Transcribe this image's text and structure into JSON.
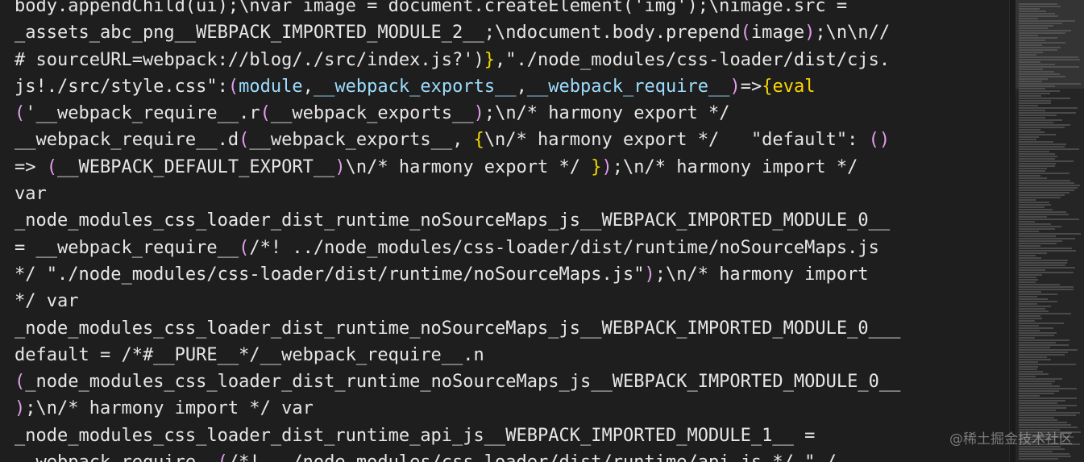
{
  "editor": {
    "lines": [
      [
        {
          "t": "body.appendChild(ui);\\nvar image = document.createElement('img');\\nimage.src =",
          "c": "default"
        }
      ],
      [
        {
          "t": "_assets_abc_png__WEBPACK_IMPORTED_MODULE_2__;\\ndocument.body.prepend",
          "c": "default"
        },
        {
          "t": "(",
          "c": "paren"
        },
        {
          "t": "image",
          "c": "default"
        },
        {
          "t": ")",
          "c": "paren"
        },
        {
          "t": ";\\n\\n//",
          "c": "default"
        }
      ],
      [
        {
          "t": "# sourceURL=webpack://blog/./src/index.js?')",
          "c": "default"
        },
        {
          "t": "}",
          "c": "brace"
        },
        {
          "t": ",\"./node_modules/css-loader/dist/cjs.",
          "c": "default"
        }
      ],
      [
        {
          "t": "js!./src/style.css\":",
          "c": "default"
        },
        {
          "t": "(",
          "c": "paren"
        },
        {
          "t": "module",
          "c": "param"
        },
        {
          "t": ",",
          "c": "default"
        },
        {
          "t": "__webpack_exports__",
          "c": "param"
        },
        {
          "t": ",",
          "c": "default"
        },
        {
          "t": "__webpack_require__",
          "c": "param"
        },
        {
          "t": ")",
          "c": "paren"
        },
        {
          "t": "=>",
          "c": "default"
        },
        {
          "t": "{",
          "c": "brace"
        },
        {
          "t": "eval",
          "c": "yellow"
        }
      ],
      [
        {
          "t": "(",
          "c": "paren"
        },
        {
          "t": "'__webpack_require__.r",
          "c": "default"
        },
        {
          "t": "(",
          "c": "paren"
        },
        {
          "t": "__webpack_exports__",
          "c": "default"
        },
        {
          "t": ")",
          "c": "paren"
        },
        {
          "t": ";\\n/* harmony export */",
          "c": "default"
        }
      ],
      [
        {
          "t": "__webpack_require__.d",
          "c": "default"
        },
        {
          "t": "(",
          "c": "paren"
        },
        {
          "t": "__webpack_exports__, ",
          "c": "default"
        },
        {
          "t": "{",
          "c": "brace"
        },
        {
          "t": "\\n/* harmony export */   \"default\": ",
          "c": "default"
        },
        {
          "t": "()",
          "c": "paren"
        }
      ],
      [
        {
          "t": "=> ",
          "c": "default"
        },
        {
          "t": "(",
          "c": "paren"
        },
        {
          "t": "__WEBPACK_DEFAULT_EXPORT__",
          "c": "default"
        },
        {
          "t": ")",
          "c": "paren"
        },
        {
          "t": "\\n/* harmony export */ ",
          "c": "default"
        },
        {
          "t": "}",
          "c": "brace"
        },
        {
          "t": ")",
          "c": "paren"
        },
        {
          "t": ";\\n/* harmony import */",
          "c": "default"
        }
      ],
      [
        {
          "t": "var",
          "c": "default"
        }
      ],
      [
        {
          "t": "_node_modules_css_loader_dist_runtime_noSourceMaps_js__WEBPACK_IMPORTED_MODULE_0__",
          "c": "default"
        }
      ],
      [
        {
          "t": "= __webpack_require__",
          "c": "default"
        },
        {
          "t": "(",
          "c": "paren"
        },
        {
          "t": "/*! ../node_modules/css-loader/dist/runtime/noSourceMaps.js",
          "c": "default"
        }
      ],
      [
        {
          "t": "*/ \"./node_modules/css-loader/dist/runtime/noSourceMaps.js\"",
          "c": "default"
        },
        {
          "t": ")",
          "c": "paren"
        },
        {
          "t": ";\\n/* harmony import",
          "c": "default"
        }
      ],
      [
        {
          "t": "*/ var",
          "c": "default"
        }
      ],
      [
        {
          "t": "_node_modules_css_loader_dist_runtime_noSourceMaps_js__WEBPACK_IMPORTED_MODULE_0___",
          "c": "default"
        }
      ],
      [
        {
          "t": "default = /*#__PURE__*/__webpack_require__.n",
          "c": "default"
        }
      ],
      [
        {
          "t": "(",
          "c": "paren"
        },
        {
          "t": "_node_modules_css_loader_dist_runtime_noSourceMaps_js__WEBPACK_IMPORTED_MODULE_0__",
          "c": "default"
        }
      ],
      [
        {
          "t": ")",
          "c": "paren"
        },
        {
          "t": ";\\n/* harmony import */ var",
          "c": "default"
        }
      ],
      [
        {
          "t": "_node_modules_css_loader_dist_runtime_api_js__WEBPACK_IMPORTED_MODULE_1__ =",
          "c": "default"
        }
      ],
      [
        {
          "t": "__webpack_require__",
          "c": "default"
        },
        {
          "t": "(",
          "c": "paren"
        },
        {
          "t": "/*! ../node_modules/css-loader/dist/runtime/api.js */ \"./",
          "c": "default"
        }
      ]
    ]
  },
  "watermark": {
    "text": "@稀土掘金技术社区"
  },
  "colors": {
    "background": "#1e1e1e",
    "default_text": "#e6e6e6",
    "paren": "#e59cf0",
    "brace": "#f1d700",
    "param": "#9cdcfe"
  }
}
